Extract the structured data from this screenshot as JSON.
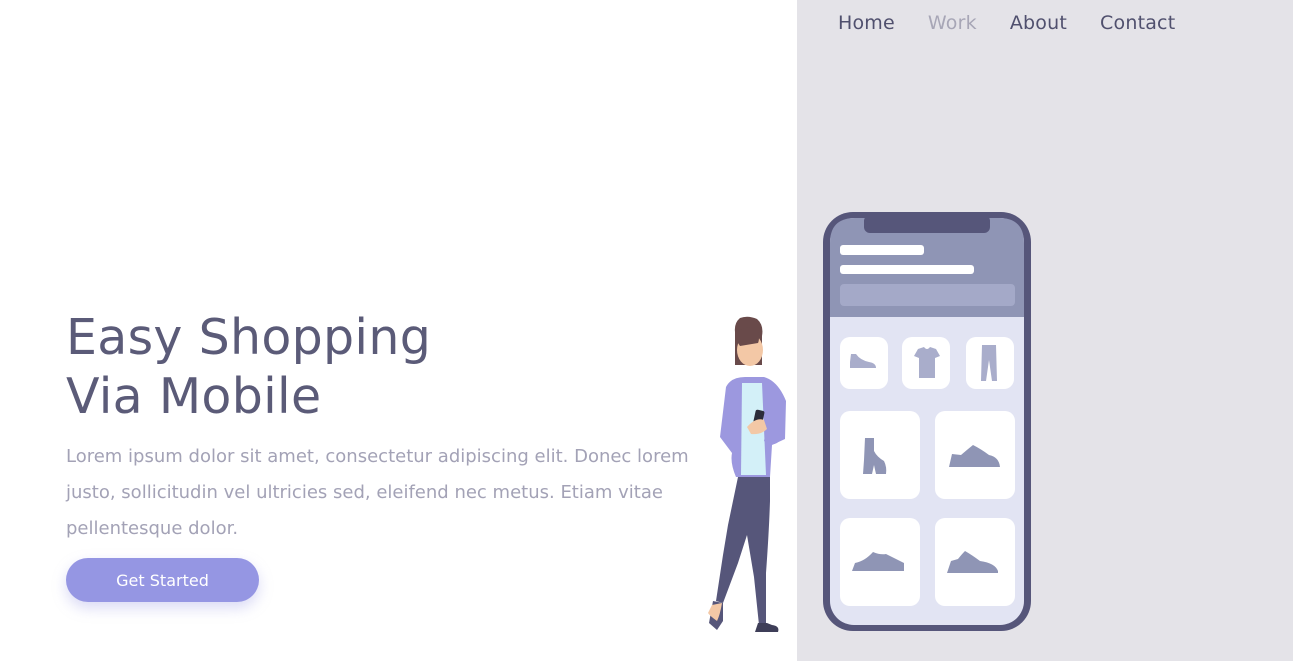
{
  "nav": {
    "items": [
      {
        "label": "Home",
        "active": false
      },
      {
        "label": "Work",
        "active": true
      },
      {
        "label": "About",
        "active": false
      },
      {
        "label": "Contact",
        "active": false
      }
    ]
  },
  "hero": {
    "title_line1": "Easy Shopping",
    "title_line2": "Via Mobile",
    "description": "Lorem ipsum dolor sit amet, consectetur adipiscing elit. Donec lorem justo, sollicitudin vel ultricies sed, eleifend nec metus. Etiam vitae pellentesque dolor.",
    "cta_label": "Get Started"
  },
  "colors": {
    "primary_text": "#5b5b78",
    "muted_text": "#a3a2b6",
    "accent": "#9596e3",
    "panel_bg": "#e4e3e8",
    "phone_frame": "#56567a"
  },
  "illustration": {
    "icons": [
      "woman-with-phone-illustration",
      "smartphone-illustration",
      "sneaker-icon",
      "tshirt-icon",
      "pants-icon",
      "boot-icon",
      "shoe-icon"
    ]
  }
}
